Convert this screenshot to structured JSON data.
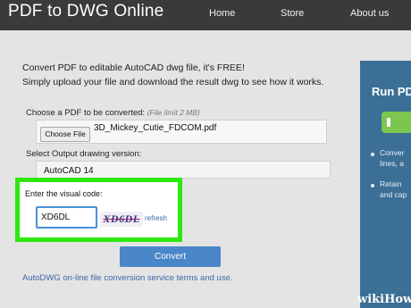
{
  "header": {
    "logo": "PDF to DWG Online",
    "nav": [
      "Home",
      "Store",
      "About us"
    ]
  },
  "main": {
    "intro_line1": "Convert PDF to editable AutoCAD dwg file, it's FREE!",
    "intro_line2": "Simply upload your file and download the result dwg to see how it works.",
    "choose_label": "Choose a PDF to be converted:",
    "choose_limit": "(File limit 2 MB)",
    "file_button": "Choose File",
    "file_name": "3D_Mickey_Cutie_FDCOM.pdf",
    "select_label": "Select Output drawing version:",
    "select_value": "AutoCAD 14",
    "captcha": {
      "label": "Enter the visual code:",
      "input_value": "XD6DL",
      "image_text": "XD6DL",
      "refresh": "refresh"
    },
    "convert_button": "Convert",
    "terms_link": "AutoDWG on-line file conversion service terms and use."
  },
  "promo": {
    "title": "Run PDF",
    "lines": [
      "Conver",
      "lines, a",
      "Retain",
      "and cap"
    ]
  },
  "watermark": {
    "wiki": "wiki",
    "how": "How"
  },
  "colors": {
    "header_bg": "#3a3a3a",
    "page_bg": "#e4e4e4",
    "highlight": "#2ee80e",
    "convert_button": "#4a87c8",
    "promo_bg": "#3b6f96",
    "link": "#3b66aa"
  }
}
